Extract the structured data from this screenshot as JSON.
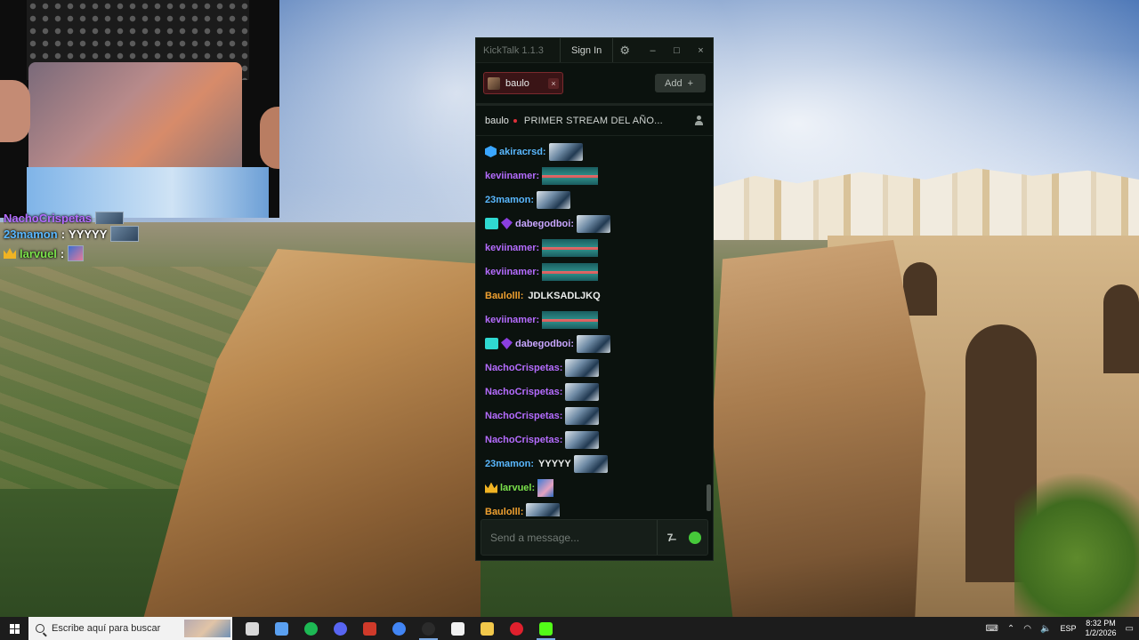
{
  "overlay_chat": {
    "lines": [
      {
        "user": "NachoCrispetas",
        "text": ""
      },
      {
        "user": "23mamon",
        "text": "YYYYY"
      },
      {
        "user": "larvuel",
        "text": ""
      }
    ]
  },
  "kicktalk": {
    "app_name": "KickTalk 1.1.3",
    "sign_in_label": "Sign In",
    "tab": {
      "label": "baulo",
      "close_glyph": "×"
    },
    "add_label": "Add",
    "add_glyph": "+",
    "channel": {
      "name": "baulo",
      "title": "PRIMER STREAM DEL AÑO..."
    },
    "input_placeholder": "Send a message...",
    "messages": [
      {
        "user": "akiracrsd:",
        "text": "",
        "color": "#5ab8ff"
      },
      {
        "user": "keviinamer:",
        "text": "",
        "color": "#b56cff"
      },
      {
        "user": "23mamon:",
        "text": "",
        "color": "#5ab8ff"
      },
      {
        "user": "dabegodboi:",
        "text": "",
        "color": "#c9a6ff"
      },
      {
        "user": "keviinamer:",
        "text": "",
        "color": "#b56cff"
      },
      {
        "user": "keviinamer:",
        "text": "",
        "color": "#b56cff"
      },
      {
        "user": "Baulolll:",
        "text": "JDLKSADLJKQ",
        "color": "#f0a030"
      },
      {
        "user": "keviinamer:",
        "text": "",
        "color": "#b56cff"
      },
      {
        "user": "dabegodboi:",
        "text": "",
        "color": "#c9a6ff"
      },
      {
        "user": "NachoCrispetas:",
        "text": "",
        "color": "#b56cff"
      },
      {
        "user": "NachoCrispetas:",
        "text": "",
        "color": "#b56cff"
      },
      {
        "user": "NachoCrispetas:",
        "text": "",
        "color": "#b56cff"
      },
      {
        "user": "NachoCrispetas:",
        "text": "",
        "color": "#b56cff"
      },
      {
        "user": "23mamon:",
        "text": "YYYYY",
        "color": "#5ab8ff"
      },
      {
        "user": "larvuel:",
        "text": "",
        "color": "#7be24b"
      },
      {
        "user": "Baulolll:",
        "text": "",
        "color": "#f0a030"
      }
    ],
    "translate_glyph": "7̶",
    "window_buttons": [
      "–",
      "□",
      "×"
    ],
    "gear_glyph": "⚙"
  },
  "taskbar": {
    "search_placeholder": "Escribe aquí para buscar",
    "language": "ESP",
    "time": "8:32 PM",
    "date": "1/2/2026",
    "apps": [
      {
        "name": "task-view",
        "color": "#d8d8d8"
      },
      {
        "name": "copilot",
        "color": "#5aa0f0"
      },
      {
        "name": "spotify",
        "color": "#1db954"
      },
      {
        "name": "discord",
        "color": "#5865f2"
      },
      {
        "name": "voice-app",
        "color": "#d03a2a"
      },
      {
        "name": "chrome",
        "color": "#4285f4"
      },
      {
        "name": "obs",
        "color": "#2b2b2b"
      },
      {
        "name": "app-dark",
        "color": "#f0f0f0"
      },
      {
        "name": "file-explorer",
        "color": "#f2c84b"
      },
      {
        "name": "opera",
        "color": "#e0202d"
      },
      {
        "name": "kick",
        "color": "#53fc18"
      }
    ]
  },
  "colors": {
    "kick_green": "#53fc18",
    "tab_red": "#7a2a2d"
  }
}
